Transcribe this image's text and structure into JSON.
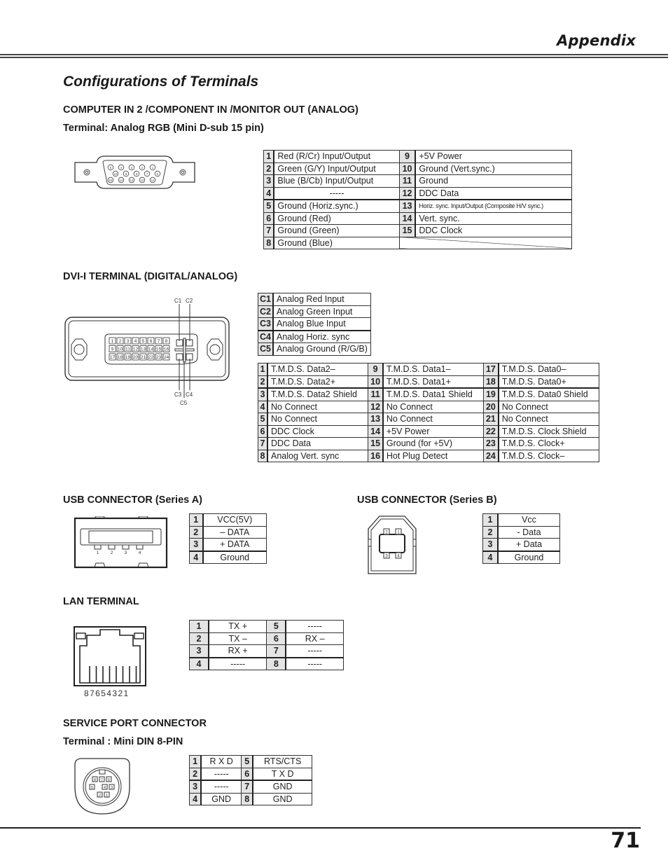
{
  "header": {
    "section": "Appendix"
  },
  "page_title": "Configurations of Terminals",
  "vga": {
    "heading": "COMPUTER IN 2 /COMPONENT IN /MONITOR OUT (ANALOG)",
    "subheading": "Terminal: Analog RGB (Mini D-sub 15 pin)",
    "pin_labels_row1": [
      "5",
      "4",
      "3",
      "2",
      "1"
    ],
    "pin_labels_row2": [
      "10",
      "9",
      "8",
      "7",
      "6"
    ],
    "pin_labels_row3": [
      "15",
      "14",
      "13",
      "12",
      "11"
    ],
    "left": [
      {
        "pin": "1",
        "signal": "Red (R/Cr) Input/Output"
      },
      {
        "pin": "2",
        "signal": "Green (G/Y) Input/Output"
      },
      {
        "pin": "3",
        "signal": "Blue (B/Cb) Input/Output"
      },
      {
        "pin": "4",
        "signal": "-----"
      },
      {
        "pin": "5",
        "signal": "Ground (Horiz.sync.)"
      },
      {
        "pin": "6",
        "signal": "Ground (Red)"
      },
      {
        "pin": "7",
        "signal": "Ground (Green)"
      },
      {
        "pin": "8",
        "signal": "Ground (Blue)"
      }
    ],
    "right": [
      {
        "pin": "9",
        "signal": "+5V Power"
      },
      {
        "pin": "10",
        "signal": "Ground (Vert.sync.)"
      },
      {
        "pin": "11",
        "signal": "Ground"
      },
      {
        "pin": "12",
        "signal": "DDC Data"
      },
      {
        "pin": "13",
        "signal": "Horiz. sync. Input/Output (Composite H/V sync.)"
      },
      {
        "pin": "14",
        "signal": "Vert. sync."
      },
      {
        "pin": "15",
        "signal": "DDC Clock"
      }
    ]
  },
  "dvi": {
    "heading": "DVI-I TERMINAL (DIGITAL/ANALOG)",
    "diagram_labels": {
      "c1": "C1",
      "c2": "C2",
      "c3": "C3",
      "c4": "C4",
      "c5": "C5"
    },
    "analog": [
      {
        "pin": "C1",
        "signal": "Analog Red Input"
      },
      {
        "pin": "C2",
        "signal": "Analog Green Input"
      },
      {
        "pin": "C3",
        "signal": "Analog Blue Input"
      },
      {
        "pin": "C4",
        "signal": "Analog Horiz. sync"
      },
      {
        "pin": "C5",
        "signal": "Analog Ground (R/G/B)"
      }
    ],
    "col1": [
      {
        "pin": "1",
        "signal": "T.M.D.S. Data2–"
      },
      {
        "pin": "2",
        "signal": "T.M.D.S. Data2+"
      },
      {
        "pin": "3",
        "signal": "T.M.D.S. Data2 Shield"
      },
      {
        "pin": "4",
        "signal": "No Connect"
      },
      {
        "pin": "5",
        "signal": "No Connect"
      },
      {
        "pin": "6",
        "signal": "DDC Clock"
      },
      {
        "pin": "7",
        "signal": "DDC Data"
      },
      {
        "pin": "8",
        "signal": "Analog Vert. sync"
      }
    ],
    "col2": [
      {
        "pin": "9",
        "signal": "T.M.D.S. Data1–"
      },
      {
        "pin": "10",
        "signal": "T.M.D.S. Data1+"
      },
      {
        "pin": "11",
        "signal": "T.M.D.S. Data1 Shield"
      },
      {
        "pin": "12",
        "signal": "No Connect"
      },
      {
        "pin": "13",
        "signal": "No Connect"
      },
      {
        "pin": "14",
        "signal": "+5V Power"
      },
      {
        "pin": "15",
        "signal": "Ground (for +5V)"
      },
      {
        "pin": "16",
        "signal": "Hot Plug Detect"
      }
    ],
    "col3": [
      {
        "pin": "17",
        "signal": "T.M.D.S. Data0–"
      },
      {
        "pin": "18",
        "signal": "T.M.D.S. Data0+"
      },
      {
        "pin": "19",
        "signal": "T.M.D.S. Data0 Shield"
      },
      {
        "pin": "20",
        "signal": "No Connect"
      },
      {
        "pin": "21",
        "signal": "No Connect"
      },
      {
        "pin": "22",
        "signal": "T.M.D.S. Clock Shield"
      },
      {
        "pin": "23",
        "signal": "T.M.D.S. Clock+"
      },
      {
        "pin": "24",
        "signal": "T.M.D.S. Clock–"
      }
    ]
  },
  "usb_a": {
    "heading": "USB CONNECTOR (Series A)",
    "diagram_pins": [
      "1",
      "2",
      "3",
      "4"
    ],
    "rows": [
      {
        "pin": "1",
        "signal": "VCC(5V)"
      },
      {
        "pin": "2",
        "signal": "– DATA"
      },
      {
        "pin": "3",
        "signal": "+ DATA"
      },
      {
        "pin": "4",
        "signal": "Ground"
      }
    ]
  },
  "usb_b": {
    "heading": "USB CONNECTOR (Series B)",
    "diagram_pins": [
      "2",
      "1",
      "3",
      "4"
    ],
    "rows": [
      {
        "pin": "1",
        "signal": "Vcc"
      },
      {
        "pin": "2",
        "signal": "- Data"
      },
      {
        "pin": "3",
        "signal": "+ Data"
      },
      {
        "pin": "4",
        "signal": "Ground"
      }
    ]
  },
  "lan": {
    "heading": "LAN TERMINAL",
    "pin_order": "87654321",
    "left": [
      {
        "pin": "1",
        "signal": "TX +"
      },
      {
        "pin": "2",
        "signal": "TX –"
      },
      {
        "pin": "3",
        "signal": "RX +"
      },
      {
        "pin": "4",
        "signal": "-----"
      }
    ],
    "right": [
      {
        "pin": "5",
        "signal": "-----"
      },
      {
        "pin": "6",
        "signal": "RX –"
      },
      {
        "pin": "7",
        "signal": "-----"
      },
      {
        "pin": "8",
        "signal": "-----"
      }
    ]
  },
  "service": {
    "heading": "SERVICE PORT CONNECTOR",
    "subheading": "Terminal : Mini DIN 8-PIN",
    "diagram_pins": [
      "8",
      "7",
      "6",
      "5",
      "4",
      "3",
      "2",
      "1"
    ],
    "left": [
      {
        "pin": "1",
        "signal": "R X D"
      },
      {
        "pin": "2",
        "signal": "-----"
      },
      {
        "pin": "3",
        "signal": "-----"
      },
      {
        "pin": "4",
        "signal": "GND"
      }
    ],
    "right": [
      {
        "pin": "5",
        "signal": "RTS/CTS"
      },
      {
        "pin": "6",
        "signal": "T X D"
      },
      {
        "pin": "7",
        "signal": "GND"
      },
      {
        "pin": "8",
        "signal": "GND"
      }
    ]
  },
  "page_number": "71"
}
